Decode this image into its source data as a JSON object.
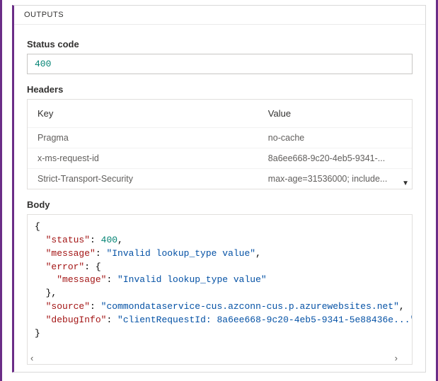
{
  "panel": {
    "title": "OUTPUTS"
  },
  "sections": {
    "status_label": "Status code",
    "headers_label": "Headers",
    "body_label": "Body"
  },
  "status_code": "400",
  "headers": {
    "columns": {
      "key": "Key",
      "value": "Value"
    },
    "rows": [
      {
        "key": "Pragma",
        "value": "no-cache"
      },
      {
        "key": "x-ms-request-id",
        "value": "8a6ee668-9c20-4eb5-9341-..."
      },
      {
        "key": "Strict-Transport-Security",
        "value": "max-age=31536000; include..."
      }
    ]
  },
  "body_json": {
    "status": 400,
    "message": "Invalid lookup_type value",
    "error": {
      "message": "Invalid lookup_type value"
    },
    "source": "commondataservice-cus.azconn-cus.p.azurewebsites.net",
    "debugInfo": "clientRequestId: 8a6ee668-9c20-4eb5-9341-5e88436e..."
  }
}
